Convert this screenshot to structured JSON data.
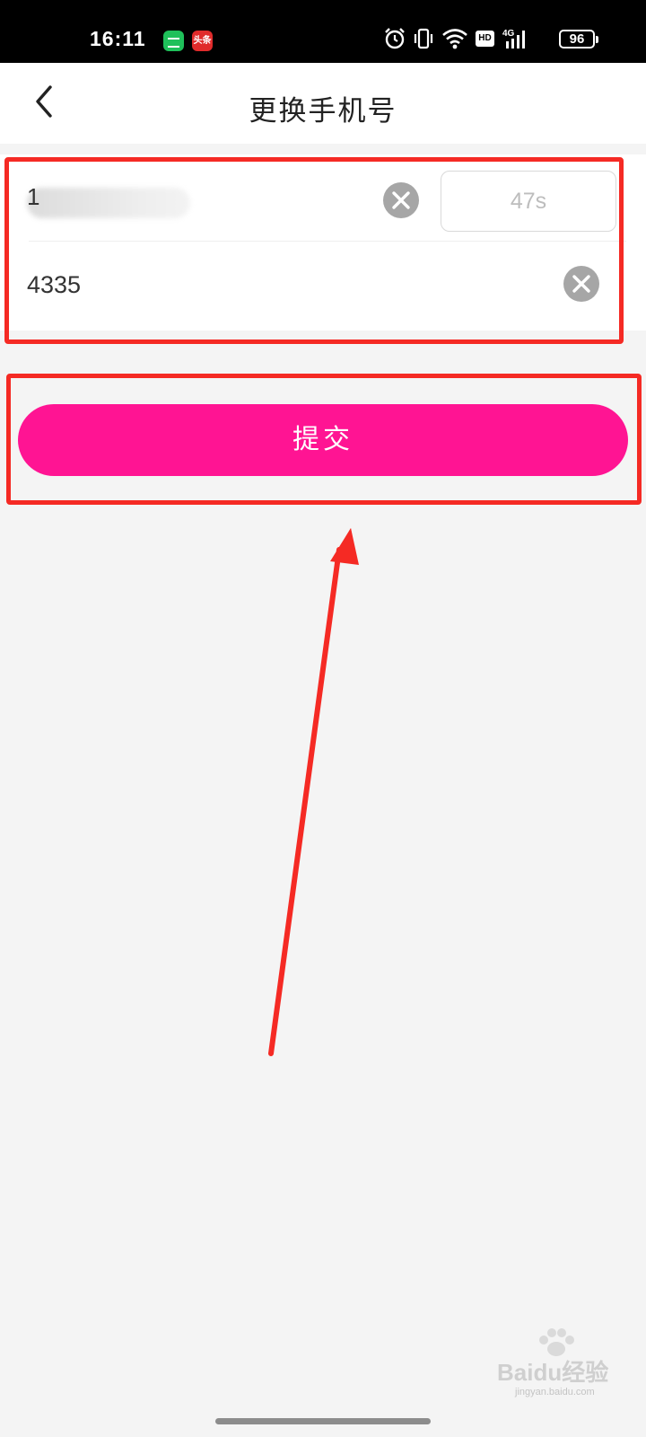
{
  "status_bar": {
    "time": "16:11",
    "app_icons": [
      "message-app-icon",
      "toutiao-app-icon"
    ],
    "toutiao_label": "头条",
    "network_label": "4G",
    "hd_label": "HD",
    "battery": "96"
  },
  "header": {
    "title": "更换手机号",
    "back_icon": "chevron-left-icon"
  },
  "form": {
    "phone_first_digit": "1",
    "countdown": "47s",
    "code_value": "4335",
    "clear_icon": "clear-circle-icon"
  },
  "submit": {
    "label": "提交",
    "color": "#ff1493"
  },
  "annotation_color": "#f52a24",
  "watermark": {
    "text": "Baidu经验",
    "sub": "jingyan.baidu.com"
  }
}
